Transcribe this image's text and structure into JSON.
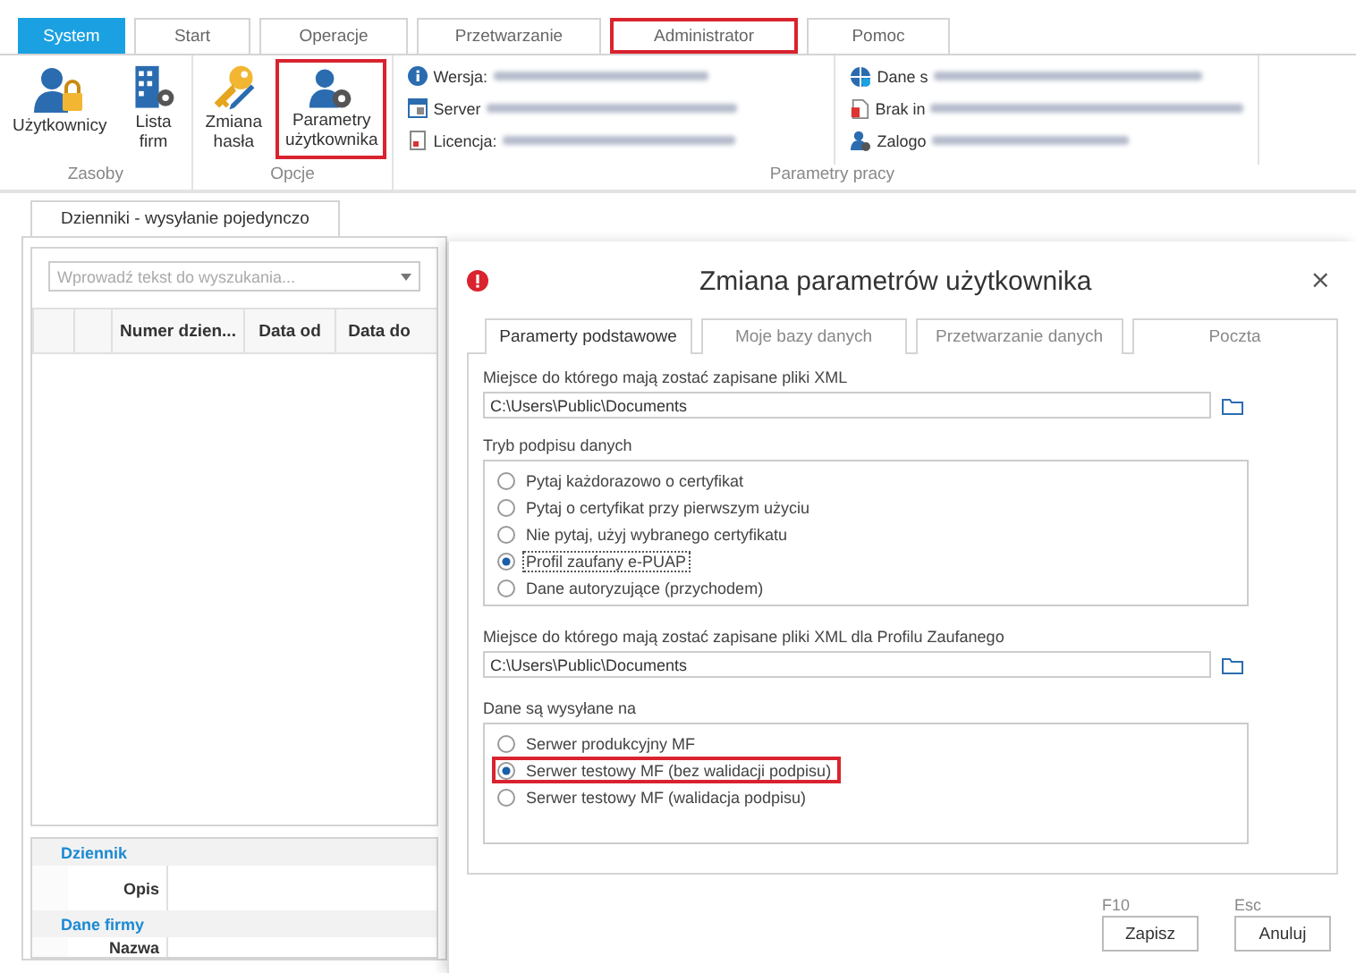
{
  "ribbon_tabs": [
    {
      "label": "System",
      "selected": true,
      "highlighted": false
    },
    {
      "label": "Start",
      "selected": false,
      "highlighted": false
    },
    {
      "label": "Operacje",
      "selected": false,
      "highlighted": false
    },
    {
      "label": "Przetwarzanie",
      "selected": false,
      "highlighted": false
    },
    {
      "label": "Administrator",
      "selected": false,
      "highlighted": true
    },
    {
      "label": "Pomoc",
      "selected": false,
      "highlighted": false
    }
  ],
  "ribbon_groups": [
    {
      "label": "Zasoby",
      "buttons": [
        {
          "label": "Użytkownicy",
          "kind": "user-lock",
          "highlighted": false
        },
        {
          "label": "Lista firm",
          "kind": "building",
          "highlighted": false
        }
      ]
    },
    {
      "label": "Opcje",
      "buttons": [
        {
          "label": "Zmiana hasła",
          "kind": "key",
          "highlighted": false
        },
        {
          "label": "Parametry użytkownika",
          "kind": "user-gear",
          "highlighted": true
        }
      ]
    }
  ],
  "work_params": {
    "label": "Parametry pracy",
    "column_1": [
      {
        "kind": "info",
        "text": "Wersja:"
      },
      {
        "kind": "server",
        "text": "Server"
      },
      {
        "kind": "license",
        "text": "Licencja:"
      }
    ],
    "column_2": [
      {
        "kind": "globe",
        "text": "Dane s"
      },
      {
        "kind": "document",
        "text": "Brak in"
      },
      {
        "kind": "user",
        "text": "Zalogo"
      }
    ]
  },
  "left_panel": {
    "tab": "Dzienniki - wysyłanie pojedynczo",
    "search": {
      "placeholder": "Wprowadź tekst do wyszukania..."
    },
    "columns": [
      "Numer dzien...",
      "Data od",
      "Data do"
    ],
    "details": [
      {
        "kind": "section",
        "text": "Dziennik"
      },
      {
        "kind": "field",
        "text": "Opis"
      },
      {
        "kind": "section",
        "text": "Dane firmy"
      },
      {
        "kind": "field",
        "text": "Nazwa"
      }
    ]
  },
  "dialog": {
    "title": "Zmiana parametrów użytkownika",
    "close": "×",
    "tabs": [
      {
        "label": "Paramerty podstawowe",
        "selected": true
      },
      {
        "label": "Moje bazy danych",
        "selected": false
      },
      {
        "label": "Przetwarzanie danych",
        "selected": false
      },
      {
        "label": "Poczta",
        "selected": false
      }
    ],
    "xml_path": {
      "label": "Miejsce do którego mają zostać zapisane pliki XML",
      "value": "C:\\Users\\Public\\Documents"
    },
    "signature_mode": {
      "label": "Tryb podpisu danych",
      "options": [
        {
          "label": "Pytaj każdorazowo o certyfikat",
          "selected": false,
          "focused": false,
          "highlighted": false
        },
        {
          "label": "Pytaj o certyfikat przy pierwszym użyciu",
          "selected": false,
          "focused": false,
          "highlighted": false
        },
        {
          "label": "Nie pytaj, użyj wybranego certyfikatu",
          "selected": false,
          "focused": false,
          "highlighted": false
        },
        {
          "label": "Profil zaufany e-PUAP",
          "selected": true,
          "focused": true,
          "highlighted": false
        },
        {
          "label": "Dane autoryzujące (przychodem)",
          "selected": false,
          "focused": false,
          "highlighted": false
        }
      ]
    },
    "epuap_path": {
      "label": "Miejsce do którego mają zostać zapisane pliki XML dla Profilu Zaufanego",
      "value": "C:\\Users\\Public\\Documents"
    },
    "send_target": {
      "label": "Dane są wysyłane na",
      "options": [
        {
          "label": "Serwer produkcyjny MF",
          "selected": false,
          "focused": false,
          "highlighted": false
        },
        {
          "label": "Serwer testowy MF (bez walidacji podpisu)",
          "selected": true,
          "focused": false,
          "highlighted": true
        },
        {
          "label": "Serwer testowy MF (walidacja podpisu)",
          "selected": false,
          "focused": false,
          "highlighted": false
        }
      ]
    },
    "buttons": [
      {
        "shortcut": "F10",
        "label": "Zapisz"
      },
      {
        "shortcut": "Esc",
        "label": "Anuluj"
      }
    ]
  }
}
